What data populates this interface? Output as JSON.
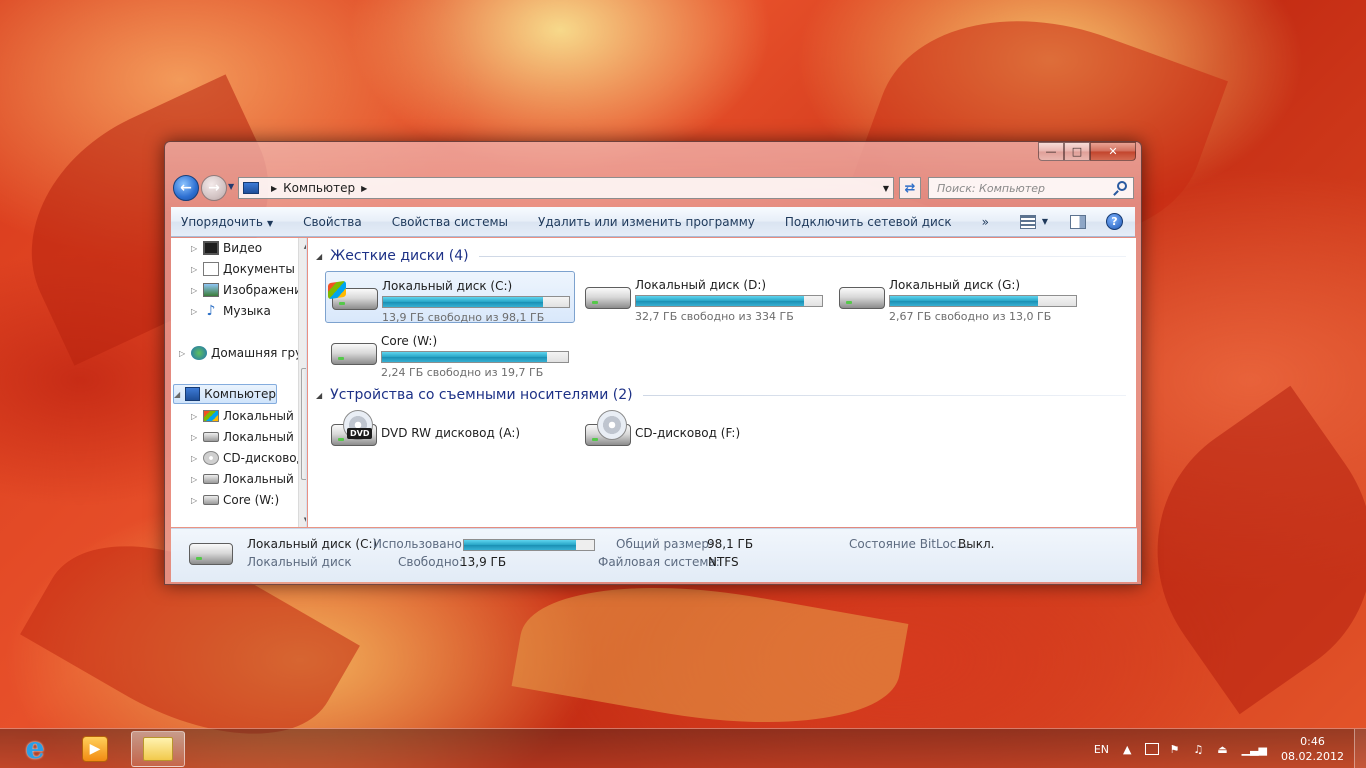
{
  "window": {
    "caption": {
      "minimize": "—",
      "maximize": "□",
      "close": "✕"
    },
    "address": {
      "location": "Компьютер"
    },
    "search": {
      "placeholder": "Поиск: Компьютер"
    },
    "toolbar": {
      "organize": "Упорядочить",
      "properties": "Свойства",
      "system_properties": "Свойства системы",
      "uninstall": "Удалить или изменить программу",
      "map_drive": "Подключить сетевой диск",
      "more": "»",
      "help": "?"
    },
    "nav_tree": [
      {
        "label": "Видео",
        "icon": "video-icon"
      },
      {
        "label": "Документы",
        "icon": "documents-icon"
      },
      {
        "label": "Изображения",
        "icon": "pictures-icon"
      },
      {
        "label": "Музыка",
        "icon": "music-icon"
      },
      {
        "label": "Домашняя группа",
        "icon": "homegroup-icon"
      },
      {
        "label": "Компьютер",
        "icon": "computer-icon",
        "selected": true
      },
      {
        "label": "Локальный диск (C:)",
        "icon": "drive-icon"
      },
      {
        "label": "Локальный диск (D:)",
        "icon": "drive-icon"
      },
      {
        "label": "CD-дисковод (F:)",
        "icon": "cd-icon"
      },
      {
        "label": "Локальный диск (G:)",
        "icon": "drive-icon"
      },
      {
        "label": "Core (W:)",
        "icon": "drive-icon"
      }
    ],
    "groups": {
      "hard_disks": {
        "title": "Жесткие диски (4)",
        "drives": [
          {
            "name": "Локальный диск (C:)",
            "free_text": "13,9 ГБ свободно из 98,1 ГБ",
            "used_fraction": 0.858
          },
          {
            "name": "Локальный диск (D:)",
            "free_text": "32,7 ГБ свободно из 334 ГБ",
            "used_fraction": 0.902
          },
          {
            "name": "Локальный диск (G:)",
            "free_text": "2,67 ГБ свободно из 13,0 ГБ",
            "used_fraction": 0.795
          },
          {
            "name": "Core (W:)",
            "free_text": "2,24 ГБ свободно из 19,7 ГБ",
            "used_fraction": 0.886
          }
        ]
      },
      "removable": {
        "title": "Устройства со съемными носителями (2)",
        "devices": [
          {
            "name": "DVD RW дисковод (A:)",
            "badge": "DVD"
          },
          {
            "name": "CD-дисковод (F:)"
          }
        ]
      }
    },
    "details": {
      "name": "Локальный диск (C:)",
      "type": "Локальный диск",
      "used_label": "Использовано:",
      "used_fraction": 0.858,
      "free_label": "Свободно:",
      "free_value": "13,9 ГБ",
      "total_label": "Общий размер:",
      "total_value": "98,1 ГБ",
      "fs_label": "Файловая система:",
      "fs_value": "NTFS",
      "bitlocker_label": "Состояние BitLoc...",
      "bitlocker_value": "Выкл."
    }
  },
  "taskbar": {
    "tray": {
      "lang": "EN",
      "time": "0:46",
      "date": "08.02.2012"
    }
  }
}
